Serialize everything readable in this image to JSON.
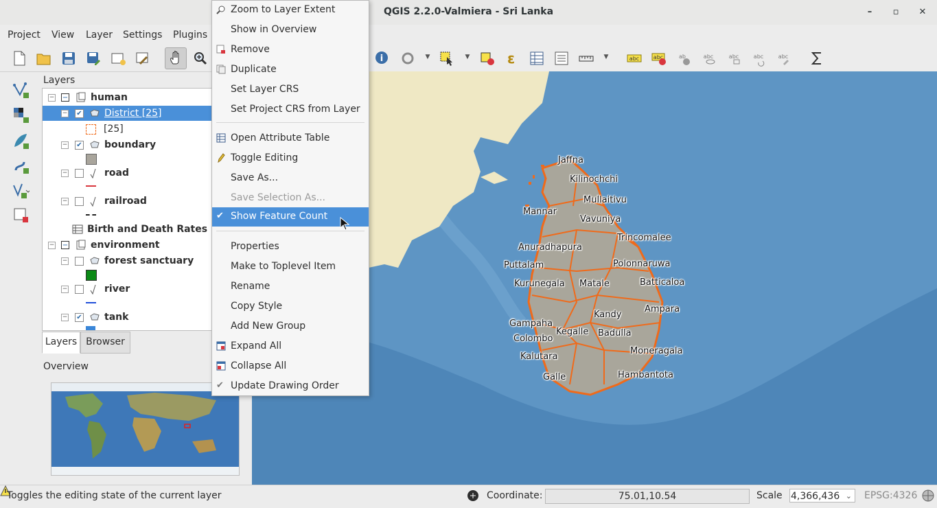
{
  "window": {
    "title": "QGIS 2.2.0-Valmiera - Sri Lanka",
    "minimize": "–",
    "maximize": "▫",
    "close": "✕"
  },
  "menubar": {
    "items": [
      "Project",
      "View",
      "Layer",
      "Settings",
      "Plugins"
    ]
  },
  "layers_panel": {
    "title": "Layers",
    "tree": [
      {
        "label": "human",
        "type": "group"
      },
      {
        "label": "District [25]",
        "type": "layer",
        "selected": true,
        "checked": true
      },
      {
        "label": "[25]",
        "type": "legend"
      },
      {
        "label": "boundary",
        "type": "layer",
        "checked": true
      },
      {
        "label": "road",
        "type": "layer",
        "checked": false
      },
      {
        "label": "railroad",
        "type": "layer",
        "checked": false
      },
      {
        "label": "Birth and Death Rates",
        "type": "table"
      },
      {
        "label": "environment",
        "type": "group"
      },
      {
        "label": "forest sanctuary",
        "type": "layer",
        "checked": false
      },
      {
        "label": "river",
        "type": "layer",
        "checked": false
      },
      {
        "label": "tank",
        "type": "layer",
        "checked": true
      }
    ],
    "tabs": [
      "Layers",
      "Browser"
    ],
    "active_tab": "Layers"
  },
  "overview": {
    "title": "Overview"
  },
  "context_menu": {
    "items": [
      {
        "label": "Zoom to Layer Extent",
        "icon": "zoom-extent-icon"
      },
      {
        "label": "Show in Overview"
      },
      {
        "label": "Remove",
        "icon": "remove-icon"
      },
      {
        "label": "Duplicate",
        "icon": "duplicate-icon"
      },
      {
        "label": "Set Layer CRS"
      },
      {
        "label": "Set Project CRS from Layer"
      },
      {
        "label": "Open Attribute Table",
        "icon": "table-icon"
      },
      {
        "label": "Toggle Editing",
        "icon": "pencil-icon"
      },
      {
        "label": "Save As..."
      },
      {
        "label": "Save Selection As...",
        "disabled": true
      },
      {
        "label": "Show Feature Count",
        "checked": true,
        "highlighted": true
      },
      {
        "label": "Properties"
      },
      {
        "label": "Make to Toplevel Item"
      },
      {
        "label": "Rename"
      },
      {
        "label": "Copy Style"
      },
      {
        "label": "Add New Group"
      },
      {
        "label": "Expand All",
        "icon": "expand-icon"
      },
      {
        "label": "Collapse All",
        "icon": "collapse-icon"
      },
      {
        "label": "Update Drawing Order",
        "checked": true
      }
    ]
  },
  "map": {
    "places": [
      "Jaffna",
      "Kilinochchi",
      "Mullaitivu",
      "Mannar",
      "Vavuniya",
      "Trincomalee",
      "Anuradhapura",
      "Polonnaruwa",
      "Puttalam",
      "Kurunegala",
      "Matale",
      "Batticaloa",
      "Kandy",
      "Ampara",
      "Gampaha",
      "Kegalle",
      "Badulla",
      "Colombo",
      "Moneragala",
      "Kalutara",
      "Galle",
      "Hambantota"
    ],
    "colors": {
      "sea": "#5e95c4",
      "land": "#efe8c4",
      "island": "#a9a69b",
      "district_border": "#f06a1a"
    }
  },
  "statusbar": {
    "message": "Toggles the editing state of the current layer",
    "coordinate_label": "Coordinate:",
    "coordinate_value": "75.01,10.54",
    "scale_label": "Scale",
    "scale_value": "4,366,436",
    "crs": "EPSG:4326"
  }
}
